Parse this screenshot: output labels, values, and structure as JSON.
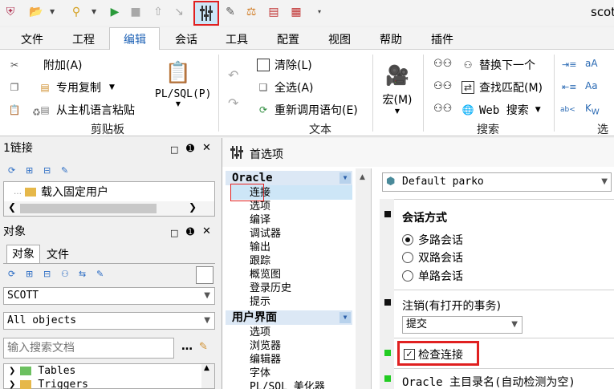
{
  "window": {
    "title": "scot"
  },
  "menu": [
    "文件",
    "工程",
    "编辑",
    "会话",
    "工具",
    "配置",
    "视图",
    "帮助",
    "插件"
  ],
  "ribbon": {
    "clipboard": {
      "add": "附加(A)",
      "special_copy": "专用复制",
      "paste_host": "从主机语言粘贴",
      "plsql": "PL/SQL(P)",
      "label": "剪贴板"
    },
    "text": {
      "clear": "清除(L)",
      "select_all": "全选(A)",
      "recall": "重新调用语句(E)",
      "label": "文本"
    },
    "macro": {
      "label": "宏(M)"
    },
    "search": {
      "replace_next": "替换下一个",
      "find_match": "查找匹配(M)",
      "web_search": "Web 搜索",
      "label": "搜索"
    },
    "select": {
      "label": "选择"
    }
  },
  "connections_panel": {
    "title": "1链接",
    "item": "载入固定用户"
  },
  "objects_panel": {
    "title": "对象",
    "tabs": [
      "对象",
      "文件"
    ],
    "schema": "SCOTT",
    "filter": "All objects",
    "search_placeholder": "输入搜索文档",
    "tree": [
      "Tables",
      "Triggers"
    ]
  },
  "prefs": {
    "title": "首选项",
    "profile": "Default parko",
    "categories": [
      {
        "heading": "Oracle",
        "items": [
          "连接",
          "选项",
          "编译",
          "调试器",
          "输出",
          "跟踪",
          "概览图",
          "登录历史",
          "提示"
        ]
      },
      {
        "heading": "用户界面",
        "items": [
          "选项",
          "浏览器",
          "编辑器",
          "字体",
          "PL/SQL 美化器"
        ]
      }
    ],
    "session_mode": {
      "label": "会话方式",
      "options": [
        "多路会话",
        "双路会话",
        "单路会话"
      ],
      "selected": "多路会话"
    },
    "logoff": {
      "label": "注销(有打开的事务)",
      "value": "提交"
    },
    "check_connection": {
      "label": "检查连接",
      "checked": true
    },
    "oracle_home": {
      "label": "Oracle 主目录名(自动检测为空)"
    }
  },
  "colors": {
    "highlight_red": "#e02020",
    "selection_blue": "#cde6f7",
    "category_bg": "#dce8f5",
    "status_green": "#22cc22"
  }
}
